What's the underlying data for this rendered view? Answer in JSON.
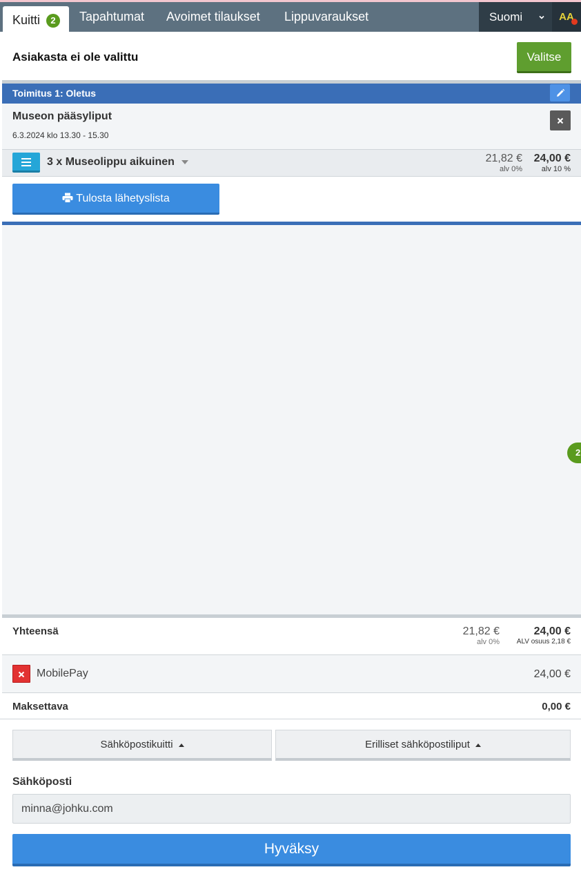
{
  "nav": {
    "tabs": [
      {
        "label": "Kuitti",
        "badge": "2",
        "active": true
      },
      {
        "label": "Tapahtumat"
      },
      {
        "label": "Avoimet tilaukset"
      },
      {
        "label": "Lippuvaraukset"
      }
    ],
    "language": "Suomi",
    "font_size_toggle": "AA"
  },
  "customer": {
    "label": "Asiakasta ei ole valittu",
    "select_button": "Valitse"
  },
  "delivery": {
    "title": "Toimitus 1: Oletus"
  },
  "event": {
    "name": "Museon pääsyliput",
    "datetime": "6.3.2024 klo 13.30 - 15.30"
  },
  "ticket": {
    "label": "3 x Museolippu aikuinen",
    "net_price": "21,82 €",
    "net_vat": "alv 0%",
    "gross_price": "24,00 €",
    "gross_vat": "alv 10 %"
  },
  "print_button": "Tulosta lähetyslista",
  "side_badge": "2",
  "totals": {
    "label": "Yhteensä",
    "net_price": "21,82 €",
    "net_vat": "alv 0%",
    "gross_price": "24,00 €",
    "vat_share": "ALV osuus 2,18 €"
  },
  "payment": {
    "method": "MobilePay",
    "amount": "24,00 €"
  },
  "due": {
    "label": "Maksettava",
    "amount": "0,00 €"
  },
  "email_receipt_button": "Sähköpostikuitti",
  "separate_tickets_button": "Erilliset sähköpostiliput",
  "email": {
    "label": "Sähköposti",
    "value": "minna@johku.com"
  },
  "accept_button": "Hyväksy",
  "colors": {
    "nav_bg": "#5d7180",
    "primary_blue": "#3a8ce0",
    "delivery_blue": "#3a6eb7",
    "success_green": "#5f9e2f",
    "danger_red": "#e23232"
  }
}
